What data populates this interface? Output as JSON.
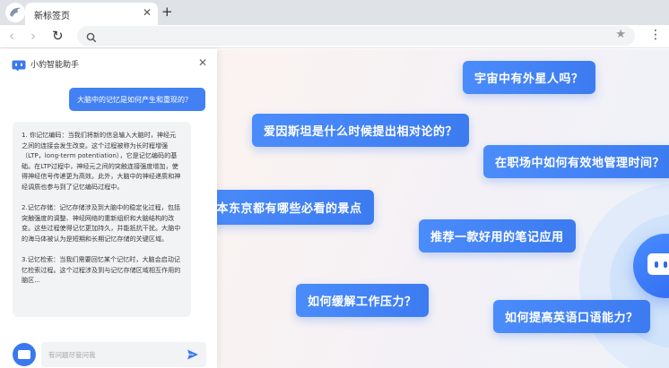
{
  "browser": {
    "tab_title": "新标签页",
    "tab_close": "✕",
    "new_tab": "+",
    "nav_back": "‹",
    "nav_forward": "›",
    "nav_reload": "↻",
    "address_value": "",
    "bookmark_star": "★",
    "menu": "⋮"
  },
  "assistant": {
    "title": "小豹智能助手",
    "close": "✕",
    "user_question": "大脑中的记忆是如何产生和重现的？",
    "answer_paragraphs": [
      "1. 你记忆编码：当我们将新的信息输入大脑时，神经元之间的连接会发生改变。这个过程被称为长时程增强（LTP，long-term potentiation），它是记忆编码的基础。在LTP过程中，神经元之间的突触连接强度增加，使得神经信号传递更为高效。此外，大脑中的神经递质和神经调质也参与到了记忆编码过程中。",
      "2.记忆存储：记忆存储涉及到大脑中的稳定化过程，包括突触强度的调整、神经网络的重新组织和大脑结构的改变。这些过程使得记忆更加持久，并能抵抗干扰。大脑中的海马体被认为是短期和长期记忆存储的关键区域。",
      "3.记忆检索：当我们需要回忆某个记忆时，大脑会启动记忆检索过程。这个过程涉及到与记忆存储区域相互作用的脑区..."
    ],
    "input_placeholder": "有问题尽管问我"
  },
  "suggestions": [
    "宇宙中有外星人吗？",
    "爱因斯坦是什么时候提出相对论的？",
    "在职场中如何有效地管理时间？",
    "日本东京都有哪些必看的景点",
    "推荐一款好用的笔记应用",
    "如何缓解工作压力？",
    "如何提高英语口语能力？"
  ],
  "colors": {
    "accent": "#4281f3",
    "chip": "#4b8cfb",
    "panel_bg": "#ffffff",
    "bubble_bg": "#f2f3f5"
  },
  "icons": {
    "browser_logo": "browser-logo-icon",
    "assistant_logo": "assistant-logo-icon",
    "search": "search-icon",
    "send": "send-icon",
    "bot": "robot-icon"
  }
}
